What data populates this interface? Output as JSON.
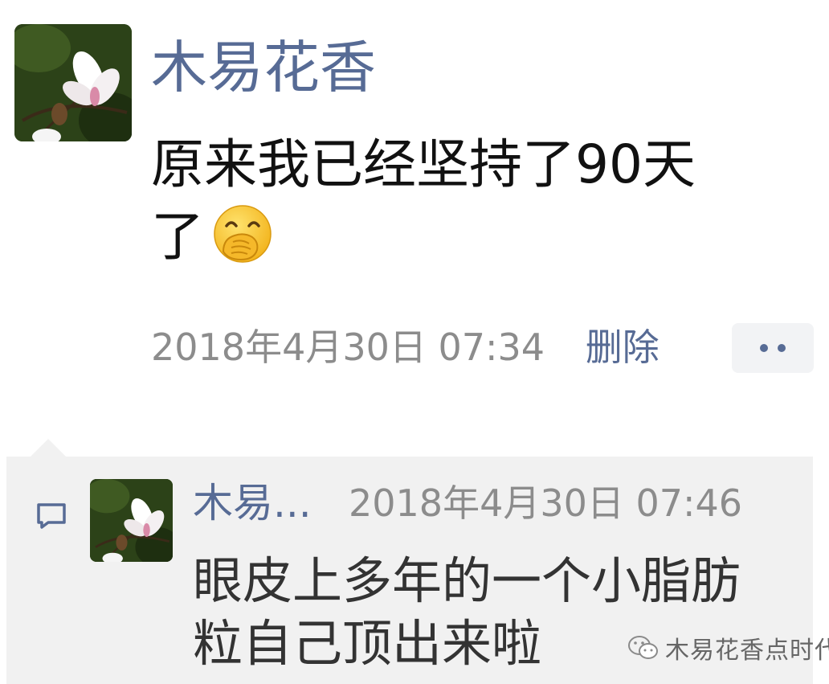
{
  "post": {
    "author": "木易花香",
    "text_lines": [
      "原来我已经坚持了90天",
      "了"
    ],
    "emoji": "face-with-hand-over-mouth-emoji",
    "timestamp": "2018年4月30日 07:34",
    "delete_label": "删除",
    "more_icon": "more-dots-icon"
  },
  "comment": {
    "icon": "comment-bubble-icon",
    "author": "木易...",
    "timestamp": "2018年4月30日 07:46",
    "text_lines": [
      "眼皮上多年的一个小脂肪",
      "粒自己顶出来啦"
    ]
  },
  "watermark": {
    "text": "木易花香点时代"
  },
  "colors": {
    "link": "#576b95",
    "meta": "#8c8c8c",
    "panel_bg": "#f1f1f1",
    "text": "#111111"
  }
}
